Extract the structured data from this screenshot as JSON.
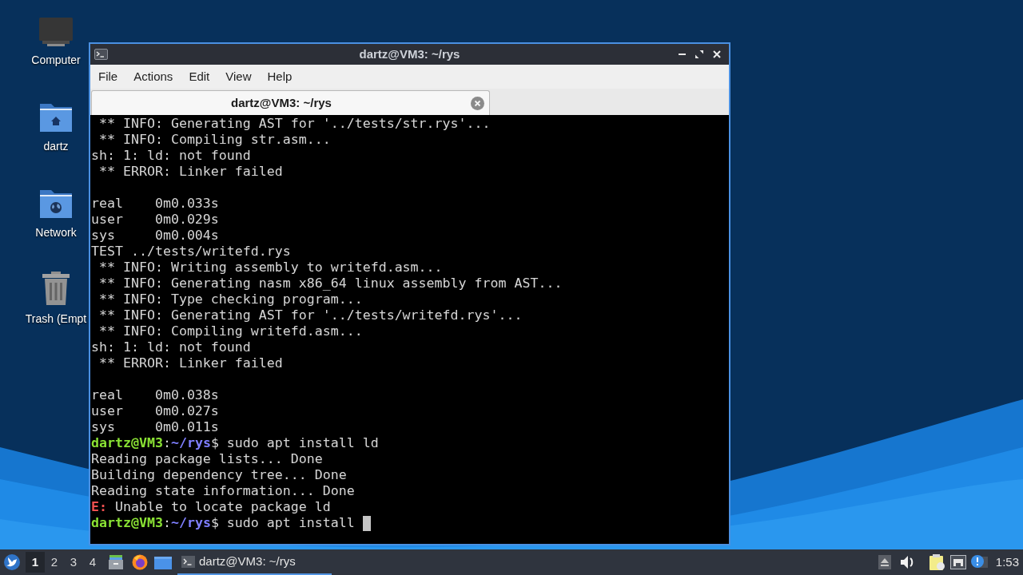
{
  "desktop_icons": [
    {
      "label": "Computer",
      "kind": "computer"
    },
    {
      "label": "dartz",
      "kind": "home"
    },
    {
      "label": "Network",
      "kind": "network"
    },
    {
      "label": "Trash (Empt",
      "kind": "trash"
    }
  ],
  "window": {
    "title": "dartz@VM3: ~/rys",
    "menu": [
      "File",
      "Actions",
      "Edit",
      "View",
      "Help"
    ],
    "tabs": [
      {
        "title": "dartz@VM3: ~/rys",
        "selected": true
      }
    ],
    "terminal": {
      "lines": [
        {
          "kind": "output",
          "text": " ** INFO: Generating AST for '../tests/str.rys'..."
        },
        {
          "kind": "output",
          "text": " ** INFO: Compiling str.asm..."
        },
        {
          "kind": "output",
          "text": "sh: 1: ld: not found"
        },
        {
          "kind": "output",
          "text": " ** ERROR: Linker failed"
        },
        {
          "kind": "blank"
        },
        {
          "kind": "output",
          "text": "real    0m0.033s"
        },
        {
          "kind": "output",
          "text": "user    0m0.029s"
        },
        {
          "kind": "output",
          "text": "sys     0m0.004s"
        },
        {
          "kind": "output",
          "text": "TEST ../tests/writefd.rys"
        },
        {
          "kind": "output",
          "text": " ** INFO: Writing assembly to writefd.asm..."
        },
        {
          "kind": "output",
          "text": " ** INFO: Generating nasm x86_64 linux assembly from AST..."
        },
        {
          "kind": "output",
          "text": " ** INFO: Type checking program..."
        },
        {
          "kind": "output",
          "text": " ** INFO: Generating AST for '../tests/writefd.rys'..."
        },
        {
          "kind": "output",
          "text": " ** INFO: Compiling writefd.asm..."
        },
        {
          "kind": "output",
          "text": "sh: 1: ld: not found"
        },
        {
          "kind": "output",
          "text": " ** ERROR: Linker failed"
        },
        {
          "kind": "blank"
        },
        {
          "kind": "output",
          "text": "real    0m0.038s"
        },
        {
          "kind": "output",
          "text": "user    0m0.027s"
        },
        {
          "kind": "output",
          "text": "sys     0m0.011s"
        },
        {
          "kind": "prompt",
          "user": "dartz@VM3",
          "separator": ":",
          "path": "~/rys",
          "symbol": "$",
          "command": "sudo apt install ld",
          "cursor": false
        },
        {
          "kind": "output",
          "text": "Reading package lists... Done"
        },
        {
          "kind": "output",
          "text": "Building dependency tree... Done"
        },
        {
          "kind": "output",
          "text": "Reading state information... Done"
        },
        {
          "kind": "error",
          "label": "E:",
          "text": "Unable to locate package ld"
        },
        {
          "kind": "prompt",
          "user": "dartz@VM3",
          "separator": ":",
          "path": "~/rys",
          "symbol": "$",
          "command": "sudo apt install",
          "cursor": true
        }
      ]
    }
  },
  "taskbar": {
    "workspaces": [
      {
        "label": "1",
        "selected": true
      },
      {
        "label": "2",
        "selected": false
      },
      {
        "label": "3",
        "selected": false
      },
      {
        "label": "4",
        "selected": false
      }
    ],
    "tasks": [
      {
        "title": "dartz@VM3: ~/rys",
        "selected": true
      }
    ],
    "clock": "1:53"
  }
}
